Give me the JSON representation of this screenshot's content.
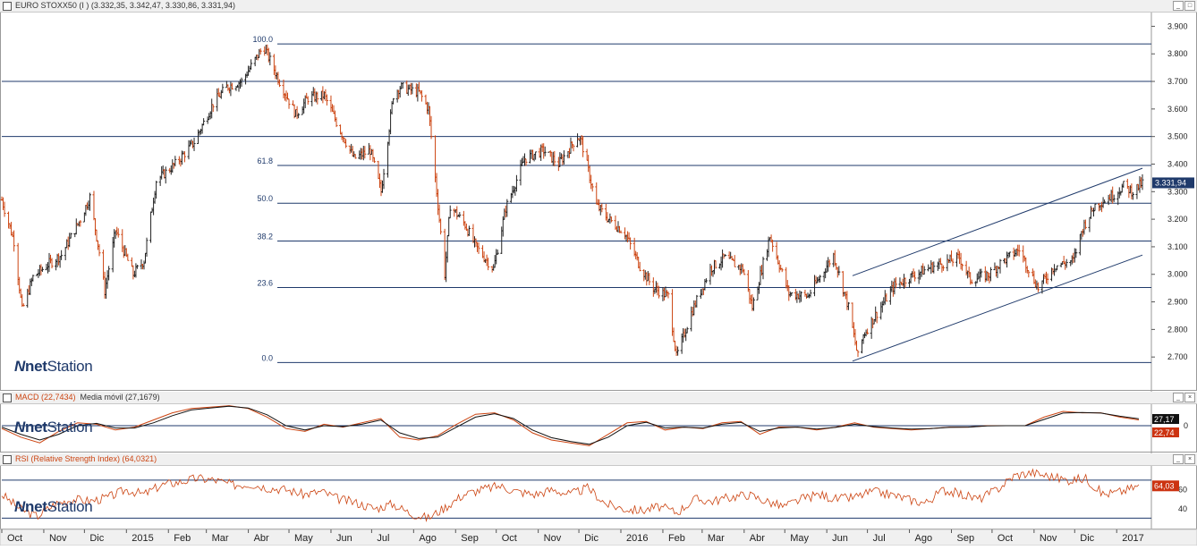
{
  "colors": {
    "price_bar": "#cc4411",
    "price_bar_alt": "#222222",
    "hline": "#1f3a6b",
    "channel": "#1f3a6b",
    "macd_line": "#cc4411",
    "macd_signal": "#111111",
    "rsi_line": "#cc4411",
    "badge_bg": "#1f3a6b",
    "badge_red": "#cc3311",
    "badge_black": "#111111"
  },
  "headers": {
    "main": "EURO STOXX50 (I ) (3.332,35, 3.342,47, 3.330,86, 3.331,94)",
    "macd": "MACD (22,7434)",
    "macd_ma": "Media móvil (27,1679)",
    "rsi": "RSI (Relative Strength Index) (64,0321)"
  },
  "logo": {
    "mark": "N",
    "net": "net",
    "station": "Station"
  },
  "chart_data": [
    {
      "type": "ohlc",
      "name": "EURO STOXX50 (I )",
      "last_values": {
        "open": 3332.35,
        "high": 3342.47,
        "low": 3330.86,
        "close": 3331.94
      },
      "last_price_label": "3.331,94",
      "ylim": [
        2600,
        3950
      ],
      "y_ticks": [
        "3.900",
        "3.800",
        "3.700",
        "3.600",
        "3.500",
        "3.400",
        "3.300",
        "3.200",
        "3.100",
        "3.000",
        "2.900",
        "2.800",
        "2.700"
      ],
      "y_tick_values": [
        3900,
        3800,
        3700,
        3600,
        3500,
        3400,
        3300,
        3200,
        3100,
        3000,
        2900,
        2800,
        2700
      ],
      "x_labels": [
        "Oct",
        "Nov",
        "Dic",
        "2015",
        "Feb",
        "Mar",
        "Abr",
        "May",
        "Jun",
        "Jul",
        "Ago",
        "Sep",
        "Oct",
        "Nov",
        "Dic",
        "2016",
        "Feb",
        "Mar",
        "Abr",
        "May",
        "Jun",
        "Jul",
        "Ago",
        "Sep",
        "Oct",
        "Nov",
        "Dic",
        "2017"
      ],
      "x_start": "2014-10-01",
      "x_end": "2017-01-20",
      "fibonacci": [
        {
          "label": "100.0",
          "value": 3836
        },
        {
          "label": "61.8",
          "value": 3395
        },
        {
          "label": "50.0",
          "value": 3258
        },
        {
          "label": "38.2",
          "value": 3121
        },
        {
          "label": "23.6",
          "value": 2952
        },
        {
          "label": "0.0",
          "value": 2680
        }
      ],
      "horizontal_lines": [
        3700,
        3500
      ],
      "channel": {
        "upper": [
          [
            "2016-06-20",
            2995
          ],
          [
            "2017-01-20",
            3385
          ]
        ],
        "lower": [
          [
            "2016-06-20",
            2685
          ],
          [
            "2017-01-20",
            3070
          ]
        ]
      },
      "closes": [
        [
          "2014-10-01",
          3270
        ],
        [
          "2014-10-10",
          3120
        ],
        [
          "2014-10-16",
          2870
        ],
        [
          "2014-10-24",
          2990
        ],
        [
          "2014-11-05",
          3040
        ],
        [
          "2014-11-14",
          3070
        ],
        [
          "2014-11-28",
          3200
        ],
        [
          "2014-12-05",
          3280
        ],
        [
          "2014-12-12",
          3080
        ],
        [
          "2014-12-16",
          2940
        ],
        [
          "2014-12-24",
          3160
        ],
        [
          "2015-01-06",
          3000
        ],
        [
          "2015-01-14",
          3050
        ],
        [
          "2015-01-23",
          3340
        ],
        [
          "2015-02-06",
          3400
        ],
        [
          "2015-02-20",
          3480
        ],
        [
          "2015-03-06",
          3620
        ],
        [
          "2015-03-16",
          3680
        ],
        [
          "2015-03-27",
          3700
        ],
        [
          "2015-04-10",
          3810
        ],
        [
          "2015-04-13",
          3820
        ],
        [
          "2015-04-24",
          3700
        ],
        [
          "2015-05-06",
          3580
        ],
        [
          "2015-05-15",
          3640
        ],
        [
          "2015-05-27",
          3650
        ],
        [
          "2015-06-08",
          3520
        ],
        [
          "2015-06-18",
          3420
        ],
        [
          "2015-06-30",
          3450
        ],
        [
          "2015-07-08",
          3300
        ],
        [
          "2015-07-17",
          3650
        ],
        [
          "2015-07-22",
          3680
        ],
        [
          "2015-08-05",
          3660
        ],
        [
          "2015-08-12",
          3600
        ],
        [
          "2015-08-24",
          3000
        ],
        [
          "2015-08-28",
          3250
        ],
        [
          "2015-09-08",
          3180
        ],
        [
          "2015-09-16",
          3100
        ],
        [
          "2015-09-29",
          3020
        ],
        [
          "2015-10-08",
          3240
        ],
        [
          "2015-10-22",
          3420
        ],
        [
          "2015-11-05",
          3450
        ],
        [
          "2015-11-16",
          3400
        ],
        [
          "2015-11-30",
          3500
        ],
        [
          "2015-12-03",
          3480
        ],
        [
          "2015-12-14",
          3250
        ],
        [
          "2015-12-23",
          3200
        ],
        [
          "2016-01-04",
          3150
        ],
        [
          "2016-01-15",
          3030
        ],
        [
          "2016-01-25",
          2950
        ],
        [
          "2016-02-05",
          2920
        ],
        [
          "2016-02-11",
          2700
        ],
        [
          "2016-02-22",
          2860
        ],
        [
          "2016-03-07",
          3020
        ],
        [
          "2016-03-17",
          3060
        ],
        [
          "2016-03-31",
          3020
        ],
        [
          "2016-04-07",
          2880
        ],
        [
          "2016-04-20",
          3140
        ],
        [
          "2016-05-04",
          2930
        ],
        [
          "2016-05-18",
          2920
        ],
        [
          "2016-06-06",
          3070
        ],
        [
          "2016-06-17",
          2880
        ],
        [
          "2016-06-24",
          2700
        ],
        [
          "2016-06-28",
          2780
        ],
        [
          "2016-07-08",
          2860
        ],
        [
          "2016-07-21",
          2960
        ],
        [
          "2016-08-05",
          3000
        ],
        [
          "2016-08-19",
          3030
        ],
        [
          "2016-09-07",
          3060
        ],
        [
          "2016-09-15",
          2980
        ],
        [
          "2016-09-29",
          3000
        ],
        [
          "2016-10-07",
          3040
        ],
        [
          "2016-10-21",
          3090
        ],
        [
          "2016-11-04",
          2950
        ],
        [
          "2016-11-16",
          3030
        ],
        [
          "2016-11-30",
          3050
        ],
        [
          "2016-12-07",
          3170
        ],
        [
          "2016-12-16",
          3250
        ],
        [
          "2016-12-30",
          3290
        ],
        [
          "2017-01-06",
          3320
        ],
        [
          "2017-01-13",
          3300
        ],
        [
          "2017-01-20",
          3332
        ]
      ]
    },
    {
      "type": "line",
      "name": "MACD",
      "value_label": "22,74",
      "signal_label": "27,17",
      "zero_label": "0",
      "series": [
        {
          "name": "MACD",
          "values": [
            -10,
            -40,
            -60,
            -20,
            10,
            5,
            -15,
            -5,
            20,
            45,
            60,
            65,
            70,
            60,
            30,
            -10,
            -20,
            5,
            -5,
            10,
            25,
            -40,
            -50,
            -35,
            5,
            40,
            45,
            20,
            -25,
            -50,
            -60,
            -70,
            -30,
            10,
            15,
            -15,
            -5,
            -10,
            10,
            15,
            -30,
            -5,
            -5,
            -15,
            -5,
            10,
            -5,
            -10,
            -15,
            -10,
            -5,
            -5,
            0,
            0,
            0,
            30,
            50,
            45,
            45,
            30,
            20
          ]
        },
        {
          "name": "Media móvil",
          "values": [
            -5,
            -30,
            -50,
            -30,
            0,
            8,
            -8,
            -8,
            10,
            35,
            55,
            62,
            68,
            62,
            38,
            0,
            -15,
            0,
            -3,
            5,
            20,
            -25,
            -45,
            -40,
            -5,
            30,
            42,
            25,
            -15,
            -42,
            -55,
            -65,
            -40,
            0,
            12,
            -8,
            -5,
            -8,
            5,
            12,
            -20,
            -8,
            -5,
            -12,
            -6,
            5,
            -3,
            -8,
            -12,
            -10,
            -6,
            -5,
            -1,
            0,
            0,
            22,
            44,
            46,
            44,
            33,
            24
          ]
        }
      ]
    },
    {
      "type": "line",
      "name": "RSI",
      "value_label": "64,03",
      "y_ticks": [
        "60",
        "40"
      ],
      "y_tick_values": [
        60,
        40
      ],
      "upper_line": 70,
      "lower_line": 30,
      "values": [
        55,
        40,
        32,
        45,
        50,
        48,
        52,
        60,
        55,
        65,
        68,
        72,
        70,
        65,
        66,
        62,
        60,
        55,
        58,
        50,
        46,
        40,
        45,
        35,
        30,
        42,
        55,
        60,
        64,
        58,
        55,
        60,
        55,
        62,
        45,
        40,
        38,
        42,
        36,
        50,
        48,
        52,
        55,
        48,
        42,
        50,
        55,
        50,
        52,
        58,
        55,
        50,
        46,
        60,
        55,
        50,
        60,
        75,
        78,
        74,
        70,
        72,
        55,
        58,
        64
      ]
    }
  ]
}
